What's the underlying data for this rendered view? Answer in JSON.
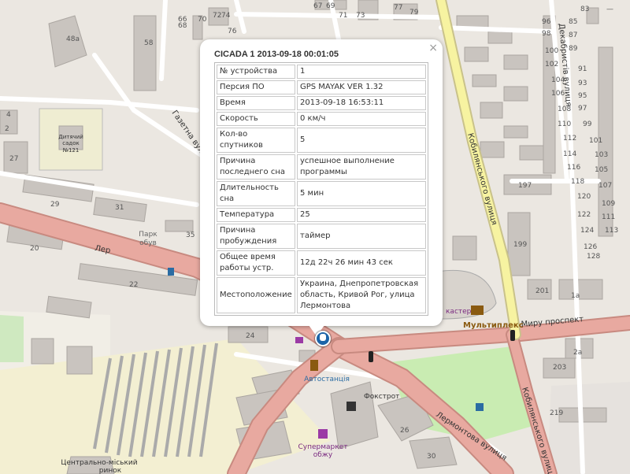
{
  "popup": {
    "title": "CICADA 1 2013-09-18 00:01:05",
    "close": "×",
    "rows": [
      {
        "k": "№ устройства",
        "v": "1"
      },
      {
        "k": "Персия ПО",
        "v": "GPS MAYAK VER 1.32"
      },
      {
        "k": "Время",
        "v": "2013-09-18 16:53:11"
      },
      {
        "k": "Скорость",
        "v": "0 км/ч"
      },
      {
        "k": "Кол-во спутников",
        "v": "5"
      },
      {
        "k": "Причина последнего сна",
        "v": "успешное выполнение программы"
      },
      {
        "k": "Длительность сна",
        "v": "5 мин"
      },
      {
        "k": "Температура",
        "v": "25"
      },
      {
        "k": "Причина пробуждения",
        "v": "таймер"
      },
      {
        "k": "Общее время работы устр.",
        "v": "12д 22ч 26 мин 43 сек"
      },
      {
        "k": "Местоположение",
        "v": "Украина, Днепропетровская область, Кривой Рог, улица Лермонтова"
      }
    ]
  },
  "map": {
    "streets": {
      "gazeta": "Газетна вулиця",
      "ler": "Лер",
      "kobylianskoho_top": "Кобилянського вулиця",
      "kobylianskoho_bottom": "Кобилянського вулиця",
      "dekabrystiv": "Декабристів вулиця",
      "myru": "Миру проспект",
      "lermontova": "Лермонтова вулиця"
    },
    "pois": {
      "kindergarten_1": "Дитячий",
      "kindergarten_2": "садок",
      "kindergarten_3": "№121",
      "park_1": "Парк",
      "park_2": "обув",
      "multiplex": "Мультиплекс",
      "kaster": "кастер",
      "bus_station": "Автостанція",
      "foxtrot": "Фокстрот",
      "supermarket_1": "Супермаркет",
      "supermarket_2": "обжу",
      "market_1": "Центрально-міський",
      "market_2": "ринок"
    },
    "house_numbers": [
      "48а",
      "58",
      "66",
      "68",
      "70",
      "72",
      "74",
      "76",
      "67",
      "69",
      "71",
      "73",
      "77",
      "79",
      "83",
      "96",
      "98",
      "87",
      "89",
      "91",
      "93",
      "95",
      "97",
      "99",
      "100",
      "102",
      "104",
      "106",
      "108",
      "110",
      "112",
      "114",
      "116",
      "118",
      "120",
      "122",
      "124",
      "126",
      "128",
      "101",
      "103",
      "105",
      "107",
      "109",
      "111",
      "113",
      "197",
      "199",
      "201",
      "1а",
      "2а",
      "203",
      "219",
      "4",
      "2",
      "27",
      "29",
      "31",
      "35",
      "20",
      "22",
      "24",
      "26",
      "30"
    ],
    "colors": {
      "road_major": "#e8a9a0",
      "road_yellow": "#f7f3a1",
      "park": "#c9ecb2",
      "building": "#c9c4bf"
    }
  }
}
